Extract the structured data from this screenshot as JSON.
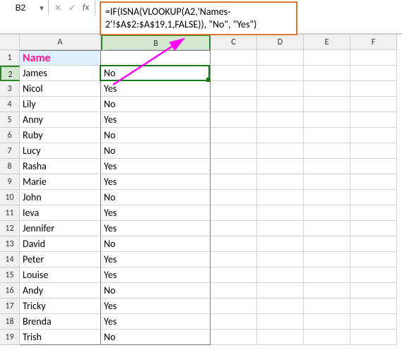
{
  "namebox": {
    "value": "B2"
  },
  "formula_bar": {
    "fx_label": "fx",
    "cancel_icon": "✕",
    "confirm_icon": "✓",
    "formula": "=IF(ISNA(VLOOKUP(A2,'Names-2'!$A$2:$A$19,1,FALSE)), \"No\", \"Yes\")"
  },
  "columns": [
    "A",
    "B",
    "C",
    "D",
    "E",
    "F"
  ],
  "rows": [
    {
      "n": 1,
      "a": "Name",
      "b": ""
    },
    {
      "n": 2,
      "a": "James",
      "b": "No"
    },
    {
      "n": 3,
      "a": "Nicol",
      "b": "Yes"
    },
    {
      "n": 4,
      "a": "Lily",
      "b": "No"
    },
    {
      "n": 5,
      "a": "Anny",
      "b": "Yes"
    },
    {
      "n": 6,
      "a": "Ruby",
      "b": "No"
    },
    {
      "n": 7,
      "a": "Lucy",
      "b": "No"
    },
    {
      "n": 8,
      "a": "Rasha",
      "b": "Yes"
    },
    {
      "n": 9,
      "a": "Marie",
      "b": "Yes"
    },
    {
      "n": 10,
      "a": "John",
      "b": "No"
    },
    {
      "n": 11,
      "a": "Ieva",
      "b": "Yes"
    },
    {
      "n": 12,
      "a": "Jennifer",
      "b": "Yes"
    },
    {
      "n": 13,
      "a": "David",
      "b": "No"
    },
    {
      "n": 14,
      "a": "Peter",
      "b": "Yes"
    },
    {
      "n": 15,
      "a": "Louise",
      "b": "Yes"
    },
    {
      "n": 16,
      "a": "Andy",
      "b": "No"
    },
    {
      "n": 17,
      "a": "Tricky",
      "b": "Yes"
    },
    {
      "n": 18,
      "a": "Brenda",
      "b": "Yes"
    },
    {
      "n": 19,
      "a": "Trish",
      "b": "No"
    }
  ],
  "active_cell": "B2",
  "colors": {
    "highlight_border": "#d73",
    "arrow": "#ff00ff",
    "header_fill": "#e0efff",
    "header_text": "#ff1493"
  }
}
